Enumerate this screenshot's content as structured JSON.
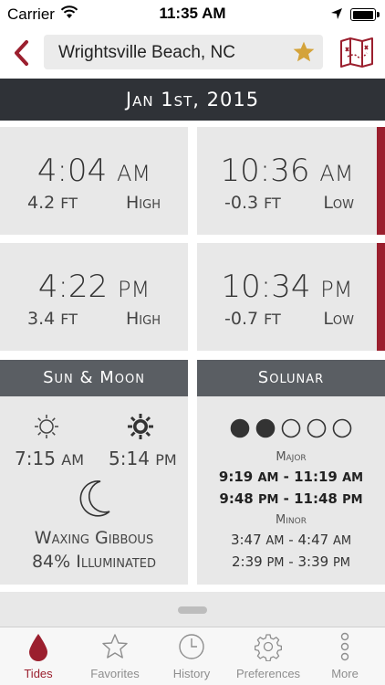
{
  "status_bar": {
    "carrier": "Carrier",
    "time": "11:35 AM"
  },
  "nav": {
    "location": "Wrightsville Beach, NC",
    "favorite": true
  },
  "date_banner": "Jan 1st, 2015",
  "tides": [
    {
      "time": "4:04",
      "ampm": "AM",
      "height": "4.2",
      "unit": "FT",
      "kind": "High"
    },
    {
      "time": "10:36",
      "ampm": "AM",
      "height": "-0.3",
      "unit": "FT",
      "kind": "Low"
    },
    {
      "time": "4:22",
      "ampm": "PM",
      "height": "3.4",
      "unit": "FT",
      "kind": "High"
    },
    {
      "time": "10:34",
      "ampm": "PM",
      "height": "-0.7",
      "unit": "FT",
      "kind": "Low"
    }
  ],
  "sun_moon": {
    "title": "Sun & Moon",
    "sunrise_time": "7:15",
    "sunrise_ampm": "AM",
    "sunset_time": "5:14",
    "sunset_ampm": "PM",
    "moon_phase": "Waxing Gibbous",
    "illumination": "84% Illuminated"
  },
  "solunar": {
    "title": "Solunar",
    "rating_filled": 2,
    "rating_total": 5,
    "major_label": "Major",
    "major": [
      {
        "start": "9:19",
        "start_ampm": "AM",
        "end": "11:19",
        "end_ampm": "AM"
      },
      {
        "start": "9:48",
        "start_ampm": "PM",
        "end": "11:48",
        "end_ampm": "PM"
      }
    ],
    "minor_label": "Minor",
    "minor": [
      {
        "start": "3:47",
        "start_ampm": "AM",
        "end": "4:47",
        "end_ampm": "AM"
      },
      {
        "start": "2:39",
        "start_ampm": "PM",
        "end": "3:39",
        "end_ampm": "PM"
      }
    ]
  },
  "tabs": [
    {
      "label": "Tides",
      "icon": "drop-icon",
      "active": true
    },
    {
      "label": "Favorites",
      "icon": "star-icon",
      "active": false
    },
    {
      "label": "History",
      "icon": "clock-icon",
      "active": false
    },
    {
      "label": "Preferences",
      "icon": "gear-icon",
      "active": false
    },
    {
      "label": "More",
      "icon": "more-dots-icon",
      "active": false
    }
  ],
  "colors": {
    "accent": "#9b1f2e",
    "banner": "#2f3237",
    "panel_header": "#5a5e63",
    "card": "#e8e8e8"
  }
}
